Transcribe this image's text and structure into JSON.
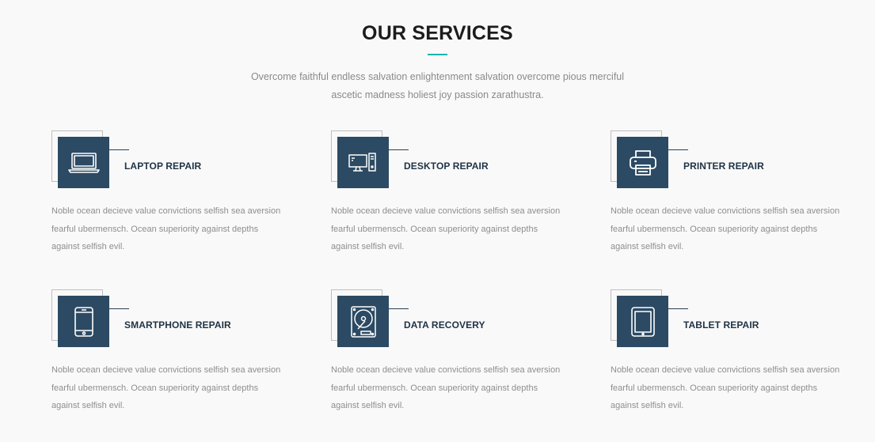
{
  "section": {
    "title": "OUR SERVICES",
    "intro": "Overcome faithful endless salvation enlightenment salvation overcome pious merciful ascetic madness holiest joy passion zarathustra.",
    "accent_color": "#19b4b4",
    "icon_bg_color": "#2c4a63"
  },
  "services": [
    {
      "title": "LAPTOP REPAIR",
      "icon": "laptop-icon",
      "text": "Noble ocean decieve value convictions selfish sea aversion fearful ubermensch. Ocean superiority against depths against selfish evil."
    },
    {
      "title": "DESKTOP REPAIR",
      "icon": "desktop-icon",
      "text": "Noble ocean decieve value convictions selfish sea aversion fearful ubermensch. Ocean superiority against depths against selfish evil."
    },
    {
      "title": "PRINTER REPAIR",
      "icon": "printer-icon",
      "text": "Noble ocean decieve value convictions selfish sea aversion fearful ubermensch. Ocean superiority against depths against selfish evil."
    },
    {
      "title": "SMARTPHONE REPAIR",
      "icon": "smartphone-icon",
      "text": "Noble ocean decieve value convictions selfish sea aversion fearful ubermensch. Ocean superiority against depths against selfish evil."
    },
    {
      "title": "DATA RECOVERY",
      "icon": "hard-drive-icon",
      "text": "Noble ocean decieve value convictions selfish sea aversion fearful ubermensch. Ocean superiority against depths against selfish evil."
    },
    {
      "title": "TABLET REPAIR",
      "icon": "tablet-icon",
      "text": "Noble ocean decieve value convictions selfish sea aversion fearful ubermensch. Ocean superiority against depths against selfish evil."
    }
  ]
}
